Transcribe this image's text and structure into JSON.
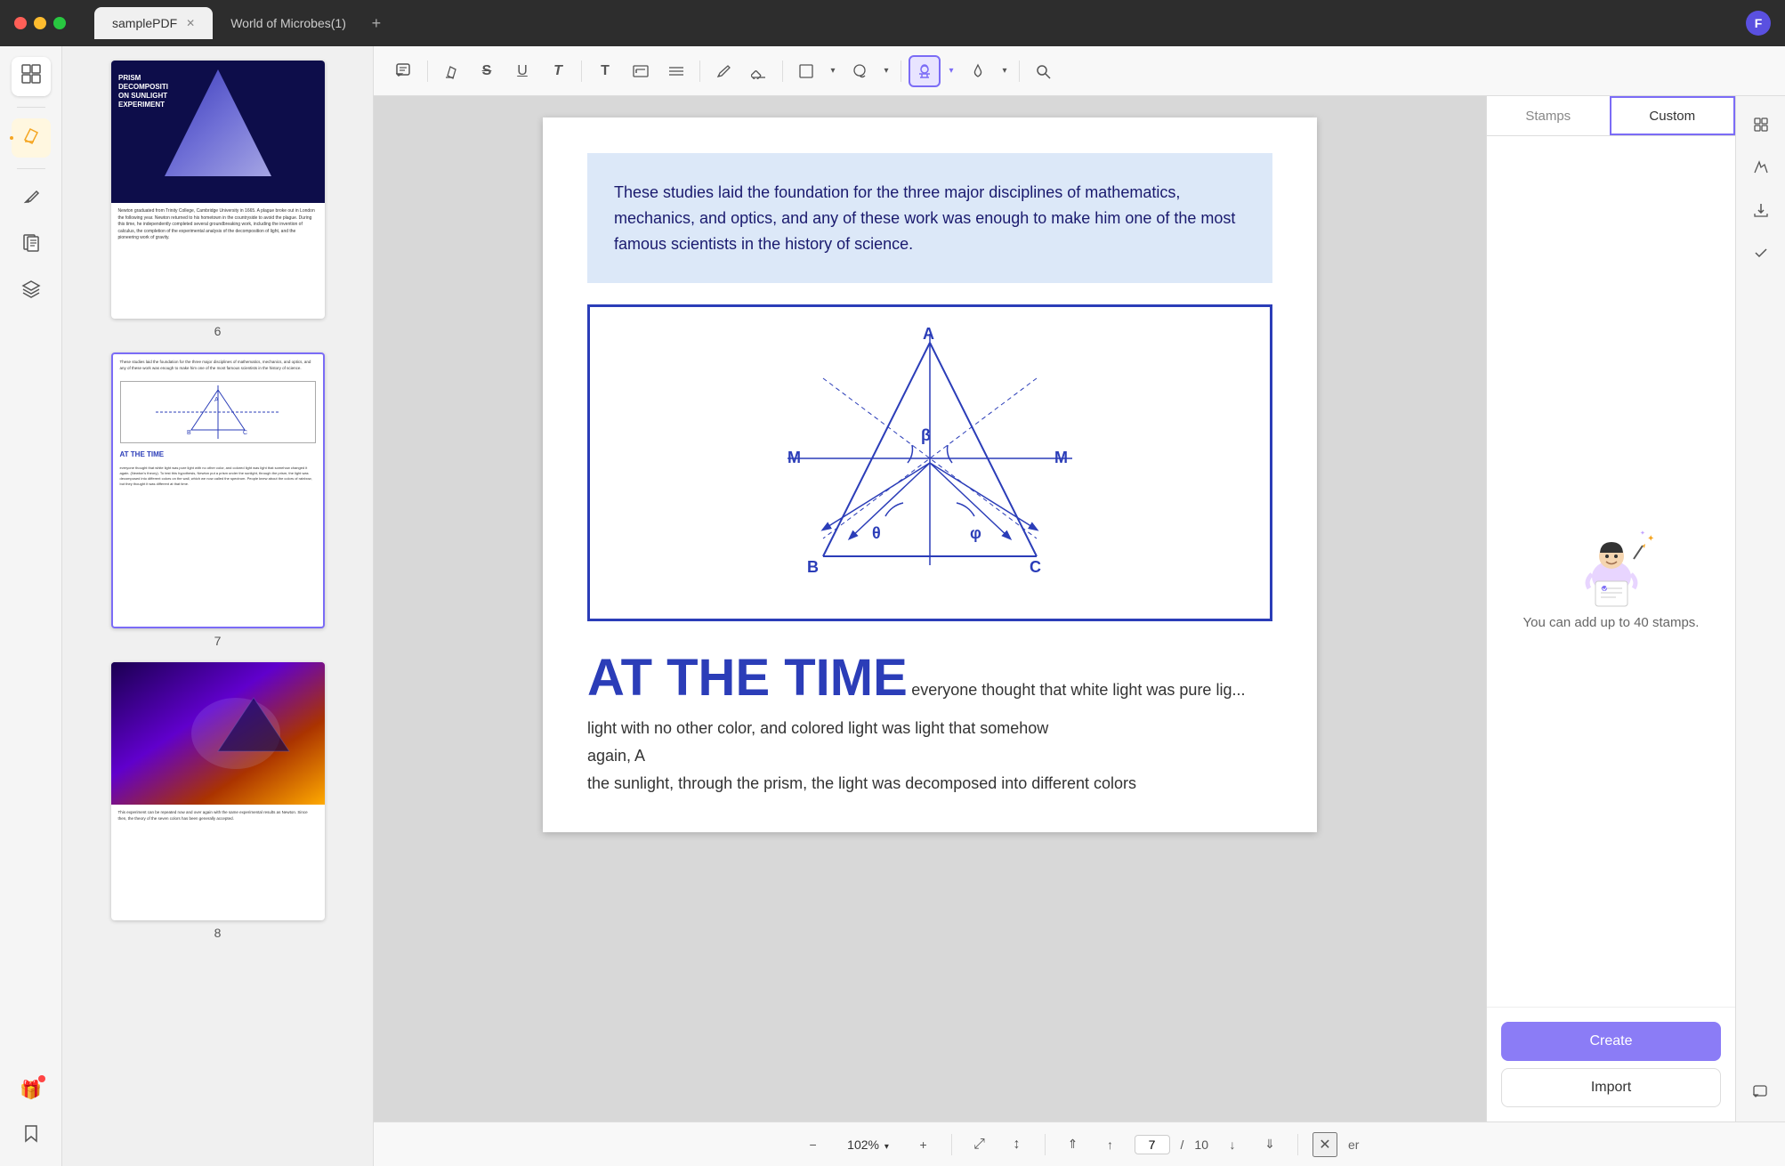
{
  "titlebar": {
    "tabs": [
      {
        "id": "tab1",
        "label": "samplePDF",
        "active": true
      },
      {
        "id": "tab2",
        "label": "World of Microbes(1)",
        "active": false
      }
    ],
    "add_tab_label": "+"
  },
  "sidebar": {
    "items": [
      {
        "id": "thumbnails",
        "icon": "☰",
        "label": "Thumbnails",
        "active": false
      },
      {
        "id": "highlight",
        "icon": "✏",
        "label": "Highlight",
        "active": true,
        "has_active_dot": true
      },
      {
        "id": "edit",
        "icon": "✒",
        "label": "Edit",
        "active": false
      },
      {
        "id": "pages",
        "icon": "⊞",
        "label": "Pages",
        "active": false
      },
      {
        "id": "layers",
        "icon": "◫",
        "label": "Layers",
        "active": false
      },
      {
        "id": "gift",
        "icon": "🎁",
        "label": "Gift",
        "active": false,
        "has_badge": true
      },
      {
        "id": "bookmark",
        "icon": "🔖",
        "label": "Bookmark",
        "active": false
      }
    ]
  },
  "toolbar": {
    "buttons": [
      {
        "id": "comment",
        "icon": "💬",
        "label": "Comment"
      },
      {
        "id": "highlight",
        "icon": "✏",
        "label": "Highlight"
      },
      {
        "id": "strikethrough",
        "icon": "S̶",
        "label": "Strikethrough"
      },
      {
        "id": "underline",
        "icon": "U",
        "label": "Underline"
      },
      {
        "id": "text-color",
        "icon": "T",
        "label": "Text Color"
      },
      {
        "id": "text",
        "icon": "T",
        "label": "Text"
      },
      {
        "id": "text-box",
        "icon": "⬚",
        "label": "Text Box"
      },
      {
        "id": "list",
        "icon": "≡",
        "label": "List"
      },
      {
        "id": "pencil",
        "icon": "✎",
        "label": "Pencil"
      },
      {
        "id": "eraser",
        "icon": "◻",
        "label": "Eraser"
      },
      {
        "id": "shapes",
        "icon": "□",
        "label": "Shapes",
        "has_dropdown": true
      },
      {
        "id": "fill",
        "icon": "◉",
        "label": "Fill Color",
        "has_dropdown": true
      },
      {
        "id": "stamp",
        "icon": "👤",
        "label": "Stamp",
        "active": true,
        "has_dropdown": true
      },
      {
        "id": "ink-color",
        "icon": "✒",
        "label": "Ink Color",
        "has_dropdown": true
      },
      {
        "id": "search",
        "icon": "🔍",
        "label": "Search"
      }
    ]
  },
  "thumbnails": {
    "pages": [
      {
        "number": 6,
        "selected": false,
        "title": "PRISM DECOMPOSITION ON SUNLIGHT EXPERIMENT",
        "body": "Newton graduated from Trinity College, Cambridge University in 1665. A plague broke out in London the following year. Newton returned to his hometown in the countryside to avoid the plague. During this time, he independently completed several groundbreaking work, including the invention of calculus, the completion of the experimental analysis of the decomposition of light, and the pioneering work of gravity."
      },
      {
        "number": 7,
        "selected": true,
        "heading": "AT THE TIME",
        "body": "everyone thought that white light was pure light with no other color, and colored light was light that somehow changed it again. (Newton's theory). To test this hypothesis, Newton put a prism under the sunlight, through the prism, the light was decomposed into different colors on the wall, which we now called the spectrum. People knew about the colors of rainbow, but they thought it was different at that time."
      },
      {
        "number": 8,
        "selected": false
      }
    ]
  },
  "main_content": {
    "top_paragraph": "These studies laid the foundation for the three major disciplines of mathematics, mechanics, and optics, and any of these work was enough to make him one of the most famous scientists in the history of science.",
    "heading": "AT THE TIME",
    "inline_text": " everyone thought that white light was pure lig...",
    "body_lines": [
      "light with no other color, and colored light was light that somehow",
      "again, A",
      "the sunlight, through the prism, the light was decomposed into different colors"
    ],
    "diagram_labels": {
      "A": "A",
      "B": "B",
      "C": "C",
      "M_left": "M",
      "M_right": "M",
      "beta": "β",
      "theta": "θ",
      "phi": "φ"
    }
  },
  "stamp_panel": {
    "tabs": [
      {
        "id": "stamps",
        "label": "Stamps",
        "active": false
      },
      {
        "id": "custom",
        "label": "Custom",
        "active": true
      }
    ],
    "empty_state_text": "You can add up to 40 stamps.",
    "create_button": "Create",
    "import_button": "Import"
  },
  "bottom_bar": {
    "zoom_out_icon": "−",
    "zoom_level": "102%",
    "zoom_in_icon": "+",
    "fit_page_icon": "⤢",
    "fit_width_icon": "↕",
    "prev_page_icon": "↑",
    "current_page": "7",
    "page_separator": "/",
    "total_pages": "10",
    "next_page_icon": "↓",
    "last_page_icon": "↓↓",
    "close_icon": "✕"
  },
  "right_toolbar": {
    "buttons": [
      {
        "id": "scan",
        "icon": "⊞",
        "label": "Scan"
      },
      {
        "id": "signature",
        "icon": "✒",
        "label": "Signature"
      },
      {
        "id": "download",
        "icon": "⬇",
        "label": "Download"
      },
      {
        "id": "check",
        "icon": "✓",
        "label": "Check"
      },
      {
        "id": "chat",
        "icon": "💬",
        "label": "Chat"
      }
    ]
  }
}
